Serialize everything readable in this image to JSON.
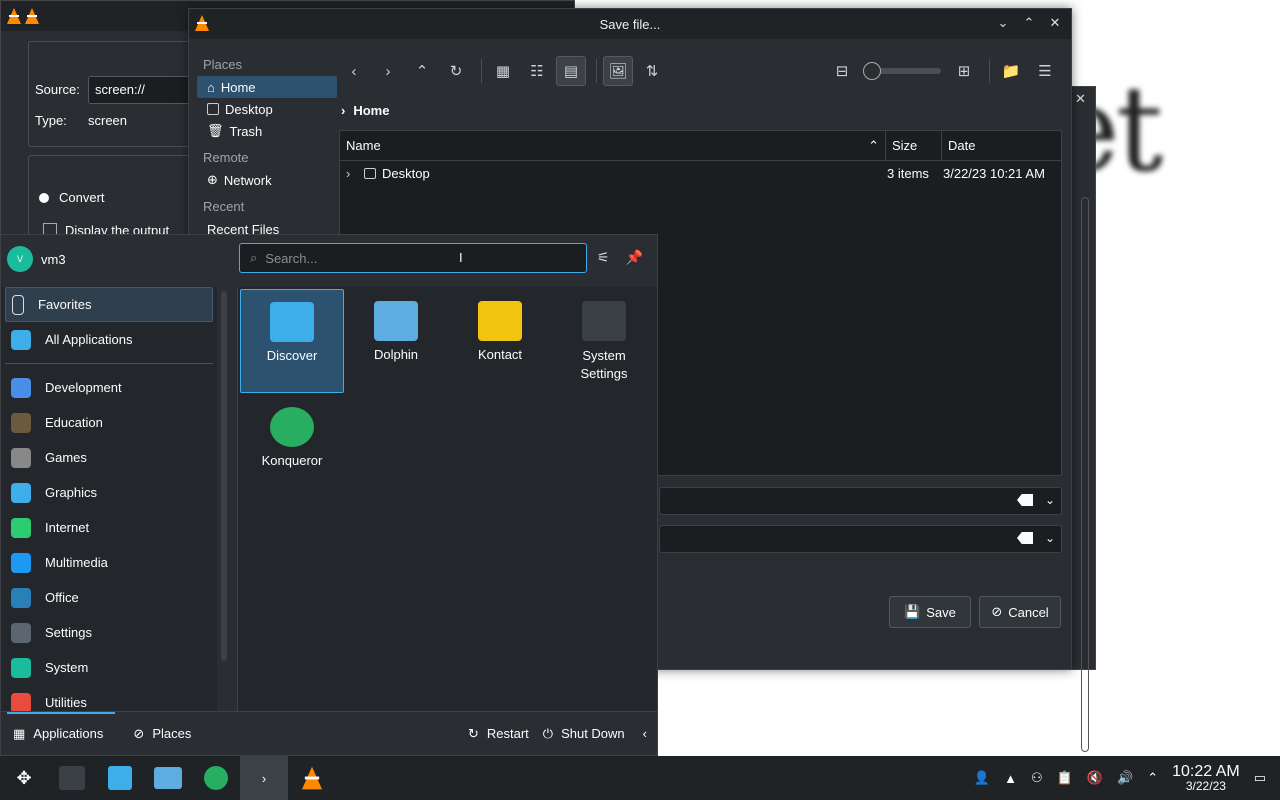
{
  "vlc_dialog": {
    "source_label": "Source:",
    "source_value": "screen://",
    "type_label": "Type:",
    "type_value": "screen",
    "convert_label": "Convert",
    "display_output_label": "Display the output"
  },
  "save_dialog": {
    "title": "Save file...",
    "places_header": "Places",
    "places": [
      "Home",
      "Desktop",
      "Trash"
    ],
    "remote_header": "Remote",
    "remote": [
      "Network"
    ],
    "recent_header": "Recent",
    "recent": [
      "Recent Files"
    ],
    "breadcrumb": "Home",
    "columns": {
      "name": "Name",
      "size": "Size",
      "date": "Date"
    },
    "rows": [
      {
        "name": "Desktop",
        "size": "3 items",
        "date": "3/22/23 10:21 AM"
      }
    ],
    "save_label": "Save",
    "cancel_label": "Cancel"
  },
  "launcher": {
    "username": "vm3",
    "avatar_letter": "V",
    "search_placeholder": "Search...",
    "categories": [
      {
        "label": "Favorites",
        "color": "#2d5270"
      },
      {
        "label": "All Applications",
        "color": "#3daee9"
      },
      {
        "label": "Development",
        "color": "#4a8fe7"
      },
      {
        "label": "Education",
        "color": "#6b5b3e"
      },
      {
        "label": "Games",
        "color": "#888888"
      },
      {
        "label": "Graphics",
        "color": "#3daee9"
      },
      {
        "label": "Internet",
        "color": "#2ecc71"
      },
      {
        "label": "Multimedia",
        "color": "#1d99f3"
      },
      {
        "label": "Office",
        "color": "#2980b9"
      },
      {
        "label": "Settings",
        "color": "#5c6670"
      },
      {
        "label": "System",
        "color": "#1abc9c"
      },
      {
        "label": "Utilities",
        "color": "#e74c3c"
      }
    ],
    "apps": [
      {
        "label": "Discover",
        "color": "#3daee9"
      },
      {
        "label": "Dolphin",
        "color": "#5dade2"
      },
      {
        "label": "Kontact",
        "color": "#f1c40f"
      },
      {
        "label": "System Settings",
        "color": "#3b4046"
      },
      {
        "label": "Konqueror",
        "color": "#27ae60"
      }
    ],
    "footer": {
      "applications": "Applications",
      "places": "Places",
      "restart": "Restart",
      "shutdown": "Shut Down"
    }
  },
  "taskbar": {
    "time": "10:22 AM",
    "date": "3/22/23"
  },
  "background_text": "et"
}
